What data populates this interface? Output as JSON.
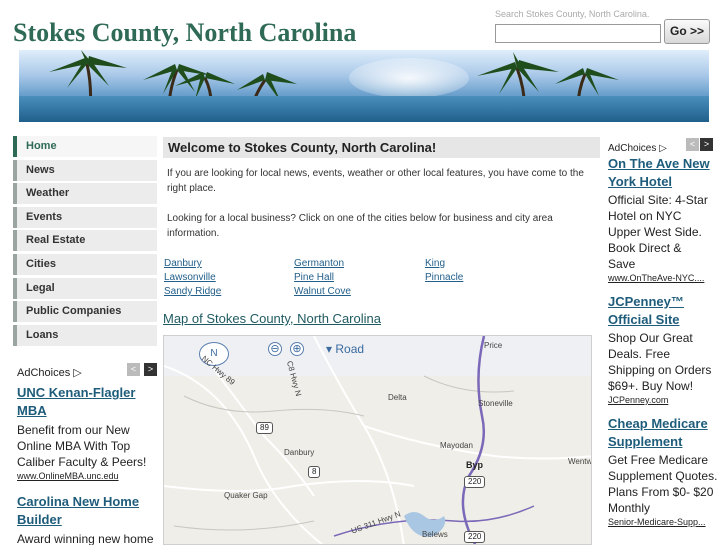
{
  "site": {
    "title": "Stokes County, North Carolina"
  },
  "search": {
    "caption": "Search Stokes County, North Carolina.",
    "value": "",
    "button_label": "Go >>"
  },
  "nav": {
    "items": [
      {
        "label": "Home",
        "active": true
      },
      {
        "label": "News"
      },
      {
        "label": "Weather"
      },
      {
        "label": "Events"
      },
      {
        "label": "Real Estate"
      },
      {
        "label": "Cities"
      },
      {
        "label": "Legal"
      },
      {
        "label": "Public Companies"
      },
      {
        "label": "Loans"
      }
    ]
  },
  "left_ads": {
    "adchoices_label": "AdChoices",
    "prev_arrow": "<",
    "next_arrow": ">",
    "ads": [
      {
        "title": "UNC Kenan-Flagler MBA",
        "body": "Benefit from our New Online MBA With Top Caliber Faculty & Peers!",
        "url": "www.OnlineMBA.unc.edu"
      },
      {
        "title": "Carolina New Home Builder",
        "body": "Award winning new home"
      }
    ]
  },
  "main": {
    "welcome_heading": "Welcome to Stokes County, North Carolina!",
    "intro_p1": "If you are looking for local news, events, weather or other local features, you have come to the right place.",
    "intro_p2": "Looking for a local business? Click on one of the cities below for business and city area information.",
    "cities": [
      "Danbury",
      "Germanton",
      "King",
      "Lawsonville",
      "Pine Hall",
      "Pinnacle",
      "Sandy Ridge",
      "Walnut Cove"
    ],
    "map_heading": "Map of Stokes County, North Carolina"
  },
  "map": {
    "zoom_out": "⊖",
    "zoom_in": "⊕",
    "view_mode": "▾ Road",
    "compass_north": "N",
    "labels": [
      "Price",
      "Delta",
      "Stoneville",
      "Mayodan",
      "Danbury",
      "Quaker Gap",
      "Wentw",
      "Belews"
    ],
    "road_labels": [
      "NC Hwy 89",
      "C8 Hwy N",
      "US 311 Hwy N",
      "Byp"
    ],
    "shields": [
      "89",
      "8",
      "220",
      "220"
    ]
  },
  "right_ads": {
    "adchoices_label": "AdChoices",
    "prev_arrow": "<",
    "next_arrow": ">",
    "ads": [
      {
        "title": "On The Ave New York Hotel",
        "body": "Official Site: 4-Star Hotel on NYC Upper West Side. Book Direct & Save",
        "url": "www.OnTheAve-NYC...."
      },
      {
        "title": "JCPenney™ Official Site",
        "body": "Shop Our Great Deals. Free Shipping on Orders $69+. Buy Now!",
        "url": "JCPenney.com"
      },
      {
        "title": "Cheap Medicare Supplement",
        "body": "Get Free Medicare Supplement Quotes. Plans From $0- $20 Monthly",
        "url": "Senior-Medicare-Supp..."
      }
    ]
  },
  "colors": {
    "brand_green": "#2f6a57",
    "link_blue": "#225f8a",
    "ad_title": "#1e5c7b"
  }
}
